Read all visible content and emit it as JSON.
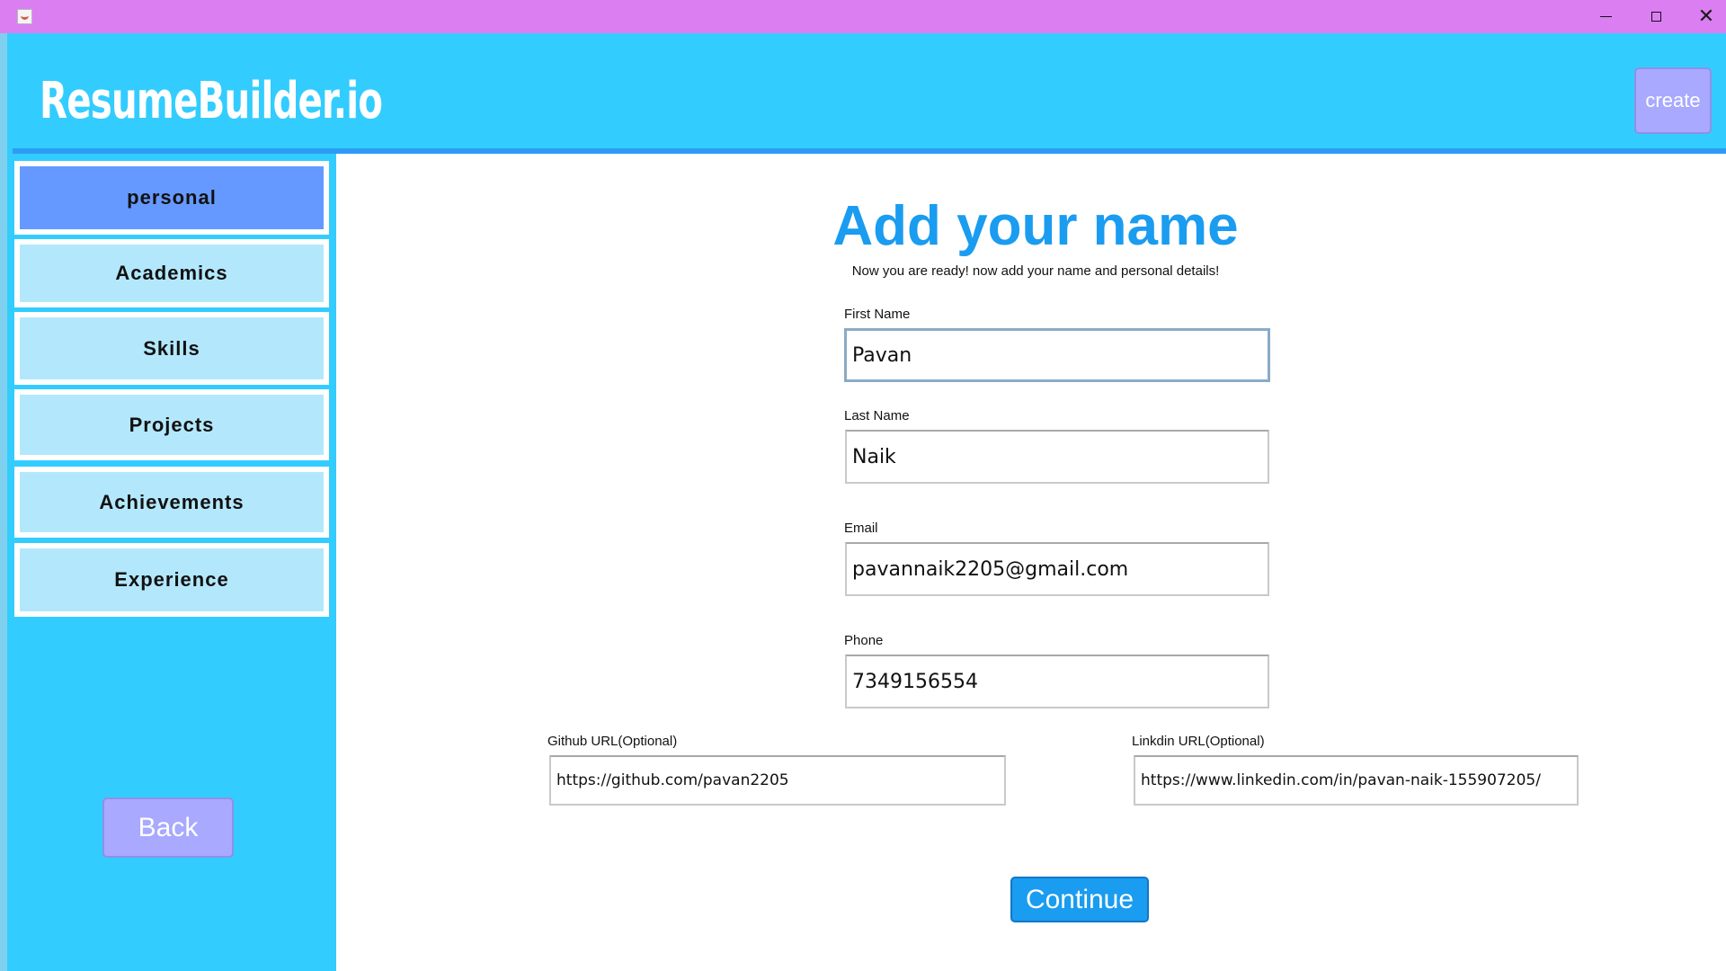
{
  "window": {
    "minimize_icon": "minimize-icon",
    "maximize_icon": "maximize-icon",
    "close_glyph": "✕"
  },
  "header": {
    "brand": "ResumeBuilder.io",
    "create_label": "create"
  },
  "sidebar": {
    "items": [
      {
        "label": "personal",
        "active": true
      },
      {
        "label": "Academics",
        "active": false
      },
      {
        "label": "Skills",
        "active": false
      },
      {
        "label": "Projects",
        "active": false
      },
      {
        "label": "Achievements",
        "active": false
      },
      {
        "label": "Experience",
        "active": false
      }
    ],
    "back_label": "Back"
  },
  "main": {
    "title": "Add your name",
    "subtitle": "Now you are ready! now add your name and personal details!",
    "fields": {
      "first_name": {
        "label": "First Name",
        "value": "Pavan"
      },
      "last_name": {
        "label": "Last Name",
        "value": "Naik"
      },
      "email": {
        "label": "Email",
        "value": "pavannaik2205@gmail.com"
      },
      "phone": {
        "label": "Phone",
        "value": "7349156554"
      },
      "github": {
        "label": "Github URL(Optional)",
        "value": "https://github.com/pavan2205"
      },
      "linkedin": {
        "label": "Linkdin URL(Optional)",
        "value": "https://www.linkedin.com/in/pavan-naik-155907205/"
      }
    },
    "continue_label": "Continue"
  },
  "colors": {
    "titlebar": "#db7ef2",
    "background": "#33ccff",
    "accent_blue": "#1a9cf0",
    "active_nav": "#6699ff",
    "nav_item": "#b3e8fc",
    "lavender_button": "#a8a9ff"
  }
}
